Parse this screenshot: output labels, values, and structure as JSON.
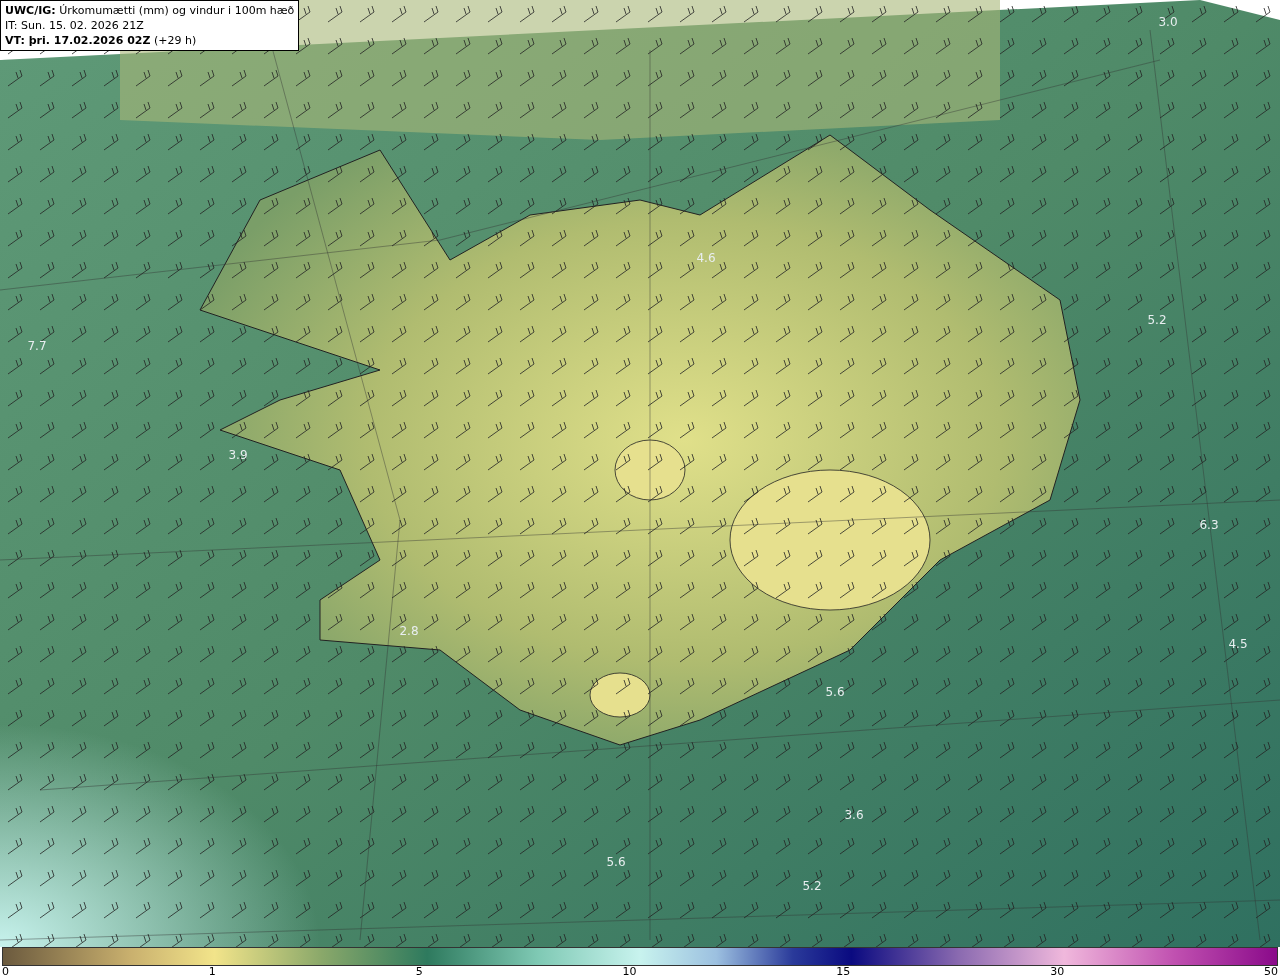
{
  "header": {
    "title": "**UWC/IG:** Úrkomumætti (mm) og vindur i 100m hæð",
    "issue_time": "IT: Sun. 15. 02. 2026 21Z",
    "valid_time": "**VT: þri. 17.02.2026 02Z** (+29 h)"
  },
  "map": {
    "labels": [
      "3.0",
      "4.6",
      "5.2",
      "7.7",
      "3.9",
      "6.3",
      "2.8",
      "4.5",
      "5.6",
      "3.6",
      "5.6",
      "5.2"
    ]
  },
  "colorbar": {
    "ticks": [
      "0",
      "1",
      "5",
      "10",
      "15",
      "30",
      "50"
    ]
  }
}
